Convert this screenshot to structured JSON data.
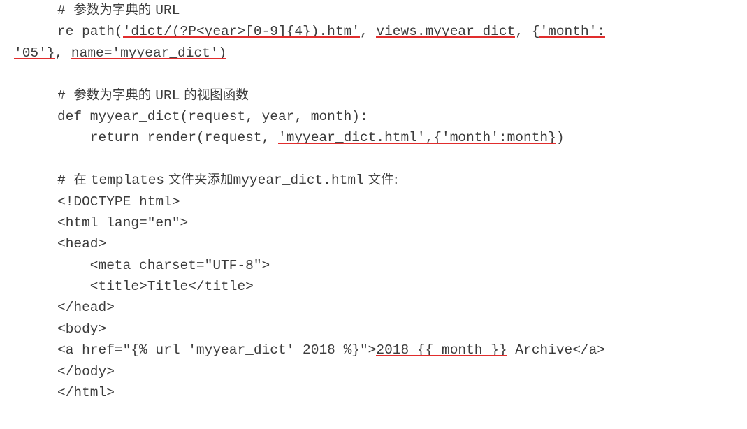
{
  "document": {
    "type": "code-listing",
    "language_mix": [
      "chinese",
      "python",
      "html"
    ],
    "colors": {
      "text": "#3b3b3b",
      "underline": "#e12d2d",
      "background": "#ffffff"
    },
    "font_size_px": 19.5,
    "line_height_px": 30.4
  },
  "lines": [
    {
      "id": "l1",
      "indent": "ind1",
      "segments": [
        {
          "text": "# ",
          "underline": false,
          "cjk": false
        },
        {
          "text": "参数为字典的 ",
          "underline": false,
          "cjk": true
        },
        {
          "text": "URL",
          "underline": false,
          "cjk": false
        }
      ]
    },
    {
      "id": "l2",
      "indent": "ind1",
      "segments": [
        {
          "text": "re_path(",
          "underline": false,
          "cjk": false
        },
        {
          "text": "'dict/(?P<year>[0-9]{4}).htm'",
          "underline": true,
          "cjk": false
        },
        {
          "text": ", ",
          "underline": false,
          "cjk": false
        },
        {
          "text": "views.myyear_dict",
          "underline": true,
          "cjk": false
        },
        {
          "text": ", {",
          "underline": false,
          "cjk": false
        },
        {
          "text": "'month':",
          "underline": true,
          "cjk": false
        }
      ]
    },
    {
      "id": "l3",
      "indent": "ind0",
      "segments": [
        {
          "text": "'05'}",
          "underline": true,
          "cjk": false
        },
        {
          "text": ", ",
          "underline": false,
          "cjk": false
        },
        {
          "text": "name='myyear_dict')",
          "underline": true,
          "cjk": false
        }
      ]
    },
    {
      "id": "l4",
      "indent": "ind1",
      "segments": [
        {
          "text": " ",
          "underline": false,
          "cjk": false
        }
      ]
    },
    {
      "id": "l5",
      "indent": "ind1",
      "segments": [
        {
          "text": "# ",
          "underline": false,
          "cjk": false
        },
        {
          "text": "参数为字典的 ",
          "underline": false,
          "cjk": true
        },
        {
          "text": "URL",
          "underline": false,
          "cjk": false
        },
        {
          "text": " 的视图函数",
          "underline": false,
          "cjk": true
        }
      ]
    },
    {
      "id": "l6",
      "indent": "ind1",
      "segments": [
        {
          "text": "def myyear_dict(request, year, month):",
          "underline": false,
          "cjk": false
        }
      ]
    },
    {
      "id": "l7",
      "indent": "ind1",
      "segments": [
        {
          "text": "    return render(request, ",
          "underline": false,
          "cjk": false
        },
        {
          "text": "'myyear_dict.html',{'month':month}",
          "underline": true,
          "cjk": false
        },
        {
          "text": ")",
          "underline": false,
          "cjk": false
        }
      ]
    },
    {
      "id": "l8",
      "indent": "ind1",
      "segments": [
        {
          "text": " ",
          "underline": false,
          "cjk": false
        }
      ]
    },
    {
      "id": "l9",
      "indent": "ind1",
      "segments": [
        {
          "text": "# ",
          "underline": false,
          "cjk": false
        },
        {
          "text": "在 ",
          "underline": false,
          "cjk": true
        },
        {
          "text": "templates",
          "underline": false,
          "cjk": false
        },
        {
          "text": " 文件夹添加",
          "underline": false,
          "cjk": true
        },
        {
          "text": "myyear_dict.html",
          "underline": false,
          "cjk": false
        },
        {
          "text": " 文件:",
          "underline": false,
          "cjk": true
        }
      ]
    },
    {
      "id": "l10",
      "indent": "ind1",
      "segments": [
        {
          "text": "<!DOCTYPE html>",
          "underline": false,
          "cjk": false
        }
      ]
    },
    {
      "id": "l11",
      "indent": "ind1",
      "segments": [
        {
          "text": "<html lang=\"en\">",
          "underline": false,
          "cjk": false
        }
      ]
    },
    {
      "id": "l12",
      "indent": "ind1",
      "segments": [
        {
          "text": "<head>",
          "underline": false,
          "cjk": false
        }
      ]
    },
    {
      "id": "l13",
      "indent": "ind1",
      "segments": [
        {
          "text": "    <meta charset=\"UTF-8\">",
          "underline": false,
          "cjk": false
        }
      ]
    },
    {
      "id": "l14",
      "indent": "ind1",
      "segments": [
        {
          "text": "    <title>Title</title>",
          "underline": false,
          "cjk": false
        }
      ]
    },
    {
      "id": "l15",
      "indent": "ind1",
      "segments": [
        {
          "text": "</head>",
          "underline": false,
          "cjk": false
        }
      ]
    },
    {
      "id": "l16",
      "indent": "ind1",
      "segments": [
        {
          "text": "<body>",
          "underline": false,
          "cjk": false
        }
      ]
    },
    {
      "id": "l17",
      "indent": "ind1",
      "segments": [
        {
          "text": "<a href=\"{% url 'myyear_dict' 2018 %}\">",
          "underline": false,
          "cjk": false
        },
        {
          "text": "2018 {{ month }}",
          "underline": true,
          "cjk": false
        },
        {
          "text": " Archive</a>",
          "underline": false,
          "cjk": false
        }
      ]
    },
    {
      "id": "l18",
      "indent": "ind1",
      "segments": [
        {
          "text": "</body>",
          "underline": false,
          "cjk": false
        }
      ]
    },
    {
      "id": "l19",
      "indent": "ind1",
      "segments": [
        {
          "text": "</html>",
          "underline": false,
          "cjk": false
        }
      ]
    }
  ]
}
